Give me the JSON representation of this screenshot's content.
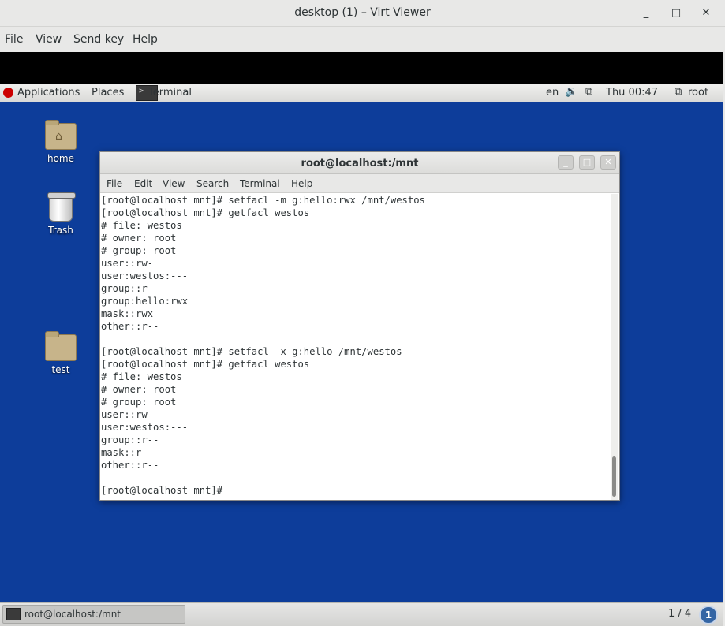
{
  "viewer": {
    "title": "desktop (1) – Virt Viewer",
    "window_buttons": {
      "minimize": "_",
      "maximize": "□",
      "close": "✕"
    },
    "menu": [
      "File",
      "View",
      "Send key",
      "Help"
    ]
  },
  "topbar": {
    "applications": "Applications",
    "places": "Places",
    "terminal": "Terminal",
    "lang": "en",
    "volume_glyph": "🔉",
    "network_glyph": "⧉",
    "clock": "Thu 00:47",
    "user_glyph": "⧉",
    "user": "root"
  },
  "desktop_icons": {
    "home": "home",
    "trash": "Trash",
    "test": "test"
  },
  "terminal": {
    "title": "root@localhost:/mnt",
    "buttons": {
      "minimize": "_",
      "maximize": "□",
      "close": "✕"
    },
    "menu": [
      "File",
      "Edit",
      "View",
      "Search",
      "Terminal",
      "Help"
    ],
    "lines": [
      "[root@localhost mnt]# setfacl -m g:hello:rwx /mnt/westos",
      "[root@localhost mnt]# getfacl westos",
      "# file: westos",
      "# owner: root",
      "# group: root",
      "user::rw-",
      "user:westos:---",
      "group::r--",
      "group:hello:rwx",
      "mask::rwx",
      "other::r--",
      "",
      "[root@localhost mnt]# setfacl -x g:hello /mnt/westos",
      "[root@localhost mnt]# getfacl westos",
      "# file: westos",
      "# owner: root",
      "# group: root",
      "user::rw-",
      "user:westos:---",
      "group::r--",
      "mask::r--",
      "other::r--",
      "",
      "[root@localhost mnt]#"
    ]
  },
  "taskbar": {
    "task_label": "root@localhost:/mnt",
    "workspace": "1 / 4",
    "workspace_button": "1"
  },
  "colors": {
    "desktop_bg": "#0d3d9a",
    "chrome_bg": "#e8e8e7",
    "terminal_fg": "#2e3436",
    "redhat_red": "#cc0000"
  }
}
